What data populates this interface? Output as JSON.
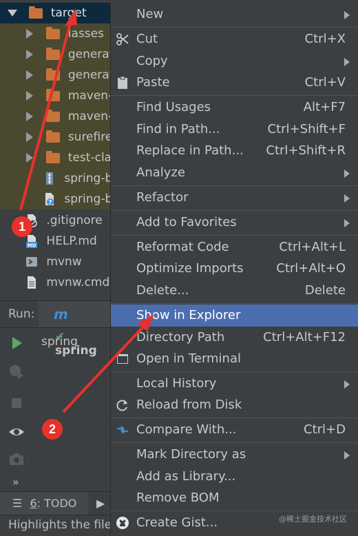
{
  "project_tree": {
    "root": {
      "label": "target",
      "icon": "folder-icon"
    },
    "children": [
      {
        "label": "classes",
        "visible_text": "lasses",
        "type": "folder"
      },
      {
        "label": "generat",
        "type": "folder"
      },
      {
        "label": "generat",
        "type": "folder"
      },
      {
        "label": "maven-",
        "type": "folder"
      },
      {
        "label": "maven-s",
        "type": "folder"
      },
      {
        "label": "surefire-",
        "type": "folder"
      },
      {
        "label": "test-clas",
        "type": "folder"
      },
      {
        "label": "spring-b",
        "type": "jar"
      },
      {
        "label": "spring-b",
        "type": "jar-original"
      }
    ],
    "files": [
      {
        "label": ".gitignore",
        "type": "gitignore"
      },
      {
        "label": "HELP.md",
        "type": "markdown"
      },
      {
        "label": "mvnw",
        "type": "script"
      },
      {
        "label": "mvnw.cmd",
        "type": "cmd"
      }
    ]
  },
  "run_panel": {
    "label": "Run:",
    "tab_label": "spring",
    "status_label": "spring"
  },
  "tool_tabs": {
    "todo_number": "6",
    "todo_label": ": TODO"
  },
  "status_bar": {
    "text": "Highlights the file"
  },
  "context_menu": {
    "items": [
      {
        "label": "New",
        "shortcut": "",
        "submenu": true
      },
      {
        "label": "Cut",
        "shortcut": "Ctrl+X",
        "icon": "scissors-icon"
      },
      {
        "label": "Copy",
        "shortcut": "",
        "submenu": true
      },
      {
        "label": "Paste",
        "shortcut": "Ctrl+V",
        "icon": "clipboard-icon"
      },
      {
        "label": "Find Usages",
        "shortcut": "Alt+F7"
      },
      {
        "label": "Find in Path...",
        "shortcut": "Ctrl+Shift+F"
      },
      {
        "label": "Replace in Path...",
        "shortcut": "Ctrl+Shift+R"
      },
      {
        "label": "Analyze",
        "shortcut": "",
        "submenu": true
      },
      {
        "label": "Refactor",
        "shortcut": "",
        "submenu": true
      },
      {
        "label": "Add to Favorites",
        "shortcut": "",
        "submenu": true
      },
      {
        "label": "Reformat Code",
        "shortcut": "Ctrl+Alt+L"
      },
      {
        "label": "Optimize Imports",
        "shortcut": "Ctrl+Alt+O"
      },
      {
        "label": "Delete...",
        "shortcut": "Delete"
      },
      {
        "label": "Show in Explorer",
        "shortcut": "",
        "selected": true
      },
      {
        "label": "Directory Path",
        "shortcut": "Ctrl+Alt+F12"
      },
      {
        "label": "Open in Terminal",
        "shortcut": "",
        "icon": "terminal-icon"
      },
      {
        "label": "Local History",
        "shortcut": "",
        "submenu": true
      },
      {
        "label": "Reload from Disk",
        "shortcut": "",
        "icon": "reload-icon"
      },
      {
        "label": "Compare With...",
        "shortcut": "Ctrl+D",
        "icon": "compare-arrows-icon"
      },
      {
        "label": "Mark Directory as",
        "shortcut": "",
        "submenu": true
      },
      {
        "label": "Add as Library...",
        "shortcut": ""
      },
      {
        "label": "Remove BOM",
        "shortcut": ""
      },
      {
        "label": "Create Gist...",
        "shortcut": "",
        "icon": "github-icon"
      }
    ]
  },
  "annotations": {
    "badge_1": "1",
    "badge_2": "2",
    "color": "#e8312c"
  },
  "colors": {
    "selection": "#4b6eaf",
    "root_selection": "#0d293e",
    "folder": "#c9733b",
    "run_green": "#59a869"
  },
  "watermark": "@稀土掘金技术社区"
}
